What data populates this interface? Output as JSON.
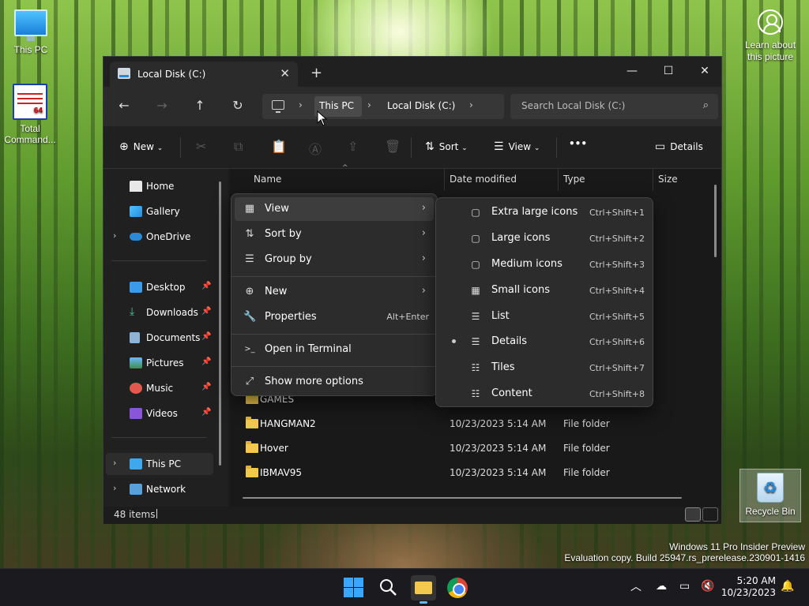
{
  "desktop": {
    "this_pc": "This PC",
    "total_commander": "Total Command...",
    "tc_badge": "64",
    "recycle_bin": "Recycle Bin",
    "learn_line1": "Learn about",
    "learn_line2": "this picture",
    "watermark_line1": "Windows 11 Pro Insider Preview",
    "watermark_line2": "Evaluation copy. Build 25947.rs_prerelease.230901-1416"
  },
  "window": {
    "tab_title": "Local Disk (C:)",
    "close_tab": "✕",
    "new_tab": "+",
    "minimize": "—",
    "maximize": "☐",
    "close": "✕"
  },
  "address": {
    "crumbs": [
      "This PC",
      "Local Disk (C:)"
    ],
    "search_placeholder": "Search Local Disk (C:)"
  },
  "command_bar": {
    "new": "New",
    "sort": "Sort",
    "view": "View",
    "more": "•••",
    "details": "Details"
  },
  "nav": {
    "items": [
      {
        "label": "Home",
        "icon": "home-icon"
      },
      {
        "label": "Gallery",
        "icon": "gallery-icon"
      },
      {
        "label": "OneDrive",
        "icon": "cloud-icon"
      },
      {
        "label": "Desktop",
        "icon": "desktop-icon"
      },
      {
        "label": "Downloads",
        "icon": "download-icon"
      },
      {
        "label": "Documents",
        "icon": "documents-icon"
      },
      {
        "label": "Pictures",
        "icon": "pictures-icon"
      },
      {
        "label": "Music",
        "icon": "music-icon"
      },
      {
        "label": "Videos",
        "icon": "videos-icon"
      },
      {
        "label": "This PC",
        "icon": "pc-icon"
      },
      {
        "label": "Network",
        "icon": "network-icon"
      }
    ]
  },
  "columns": {
    "name": "Name",
    "date": "Date modified",
    "type": "Type",
    "size": "Size"
  },
  "files": [
    {
      "name": "GAMES",
      "date": "",
      "type": ""
    },
    {
      "name": "HANGMAN2",
      "date": "10/23/2023 5:14 AM",
      "type": "File folder"
    },
    {
      "name": "Hover",
      "date": "10/23/2023 5:14 AM",
      "type": "File folder"
    },
    {
      "name": "IBMAV95",
      "date": "10/23/2023 5:14 AM",
      "type": "File folder"
    }
  ],
  "status": {
    "count": "48 items"
  },
  "context_menu": {
    "items": [
      {
        "label": "View",
        "icon": "▦",
        "arrow": "›"
      },
      {
        "label": "Sort by",
        "icon": "⇅",
        "arrow": "›"
      },
      {
        "label": "Group by",
        "icon": "☰",
        "arrow": "›"
      },
      {
        "label": "New",
        "icon": "⊕",
        "arrow": "›"
      },
      {
        "label": "Properties",
        "icon": "🔧",
        "shortcut": "Alt+Enter"
      },
      {
        "label": "Open in Terminal",
        "icon": ">_"
      },
      {
        "label": "Show more options",
        "icon": "⤢"
      }
    ]
  },
  "view_submenu": {
    "items": [
      {
        "label": "Extra large icons",
        "shortcut": "Ctrl+Shift+1",
        "icon": "▢"
      },
      {
        "label": "Large icons",
        "shortcut": "Ctrl+Shift+2",
        "icon": "▢"
      },
      {
        "label": "Medium icons",
        "shortcut": "Ctrl+Shift+3",
        "icon": "▢"
      },
      {
        "label": "Small icons",
        "shortcut": "Ctrl+Shift+4",
        "icon": "▦"
      },
      {
        "label": "List",
        "shortcut": "Ctrl+Shift+5",
        "icon": "☰"
      },
      {
        "label": "Details",
        "shortcut": "Ctrl+Shift+6",
        "icon": "☰",
        "selected": true
      },
      {
        "label": "Tiles",
        "shortcut": "Ctrl+Shift+7",
        "icon": "☷"
      },
      {
        "label": "Content",
        "shortcut": "Ctrl+Shift+8",
        "icon": "☷"
      }
    ]
  },
  "taskbar": {
    "time": "5:20 AM",
    "date": "10/23/2023"
  }
}
